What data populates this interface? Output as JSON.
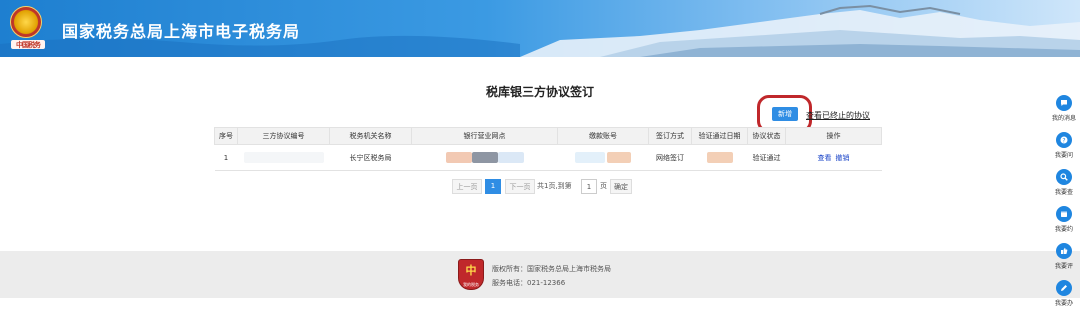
{
  "header": {
    "title": "国家税务总局上海市电子税务局",
    "emblem_caption": "中国税务"
  },
  "page": {
    "title": "税库银三方协议签订",
    "add_button": "新增",
    "view_terminated_link": "查看已终止的协议"
  },
  "table": {
    "columns": [
      "序号",
      "三方协议编号",
      "税务机关名称",
      "银行营业网点",
      "缴款账号",
      "签订方式",
      "验证通过日期",
      "协议状态",
      "操作"
    ],
    "rows": [
      {
        "index": "1",
        "agreement_no": "",
        "tax_office": "长宁区税务局",
        "bank_branch": "",
        "account_no": "",
        "sign_method": "网络签订",
        "verify_date": "",
        "status": "验证通过",
        "action_view": "查看",
        "action_cancel": "撤销"
      }
    ]
  },
  "pager": {
    "prev": "上一页",
    "current": "1",
    "next": "下一页",
    "total_text": "共1页,到第",
    "goto_value": "1",
    "page_unit": "页",
    "confirm": "确定"
  },
  "footer": {
    "copyright": "版权所有：国家税务总局上海市税务局",
    "service_phone": "服务电话：021-12366",
    "logo_text": "我的税务"
  },
  "sidebar": [
    {
      "label": "我的消息",
      "icon": "message-icon"
    },
    {
      "label": "我要问",
      "icon": "question-icon"
    },
    {
      "label": "我要查",
      "icon": "search-icon"
    },
    {
      "label": "我要约",
      "icon": "calendar-icon"
    },
    {
      "label": "我要评",
      "icon": "rating-icon"
    },
    {
      "label": "我要办",
      "icon": "edit-icon"
    }
  ],
  "colors": {
    "primary_blue": "#2f8de4",
    "highlight_red": "#c0282b",
    "link_blue": "#1a44c8"
  }
}
